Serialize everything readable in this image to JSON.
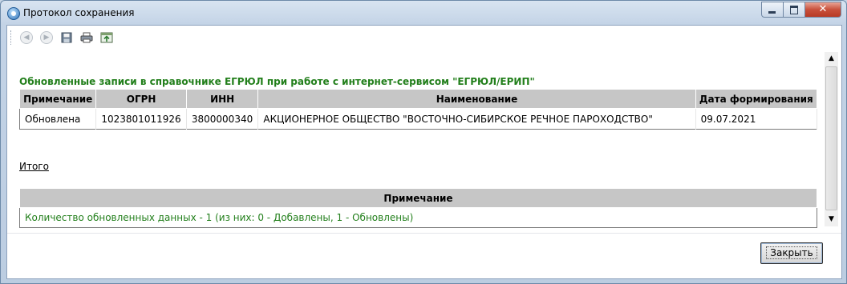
{
  "window": {
    "title": "Протокол сохранения"
  },
  "toolbar": {
    "icons": [
      "back-icon",
      "forward-icon",
      "save-icon",
      "print-icon",
      "export-icon"
    ]
  },
  "report": {
    "section_title": "Обновленные записи в справочнике ЕГРЮЛ при работе с интернет-сервисом \"ЕГРЮЛ/ЕРИП\"",
    "columns": [
      "Примечание",
      "ОГРН",
      "ИНН",
      "Наименование",
      "Дата формирования"
    ],
    "rows": [
      [
        "Обновлена",
        "1023801011926",
        "3800000340",
        "АКЦИОНЕРНОЕ ОБЩЕСТВО \"ВОСТОЧНО-СИБИРСКОЕ РЕЧНОЕ ПАРОХОДСТВО\"",
        "09.07.2021"
      ]
    ],
    "itogo_label": "Итого",
    "summary_column": "Примечание",
    "summary_text": "Количество обновленных данных - 1 (из них: 0 - Добавлены, 1 - Обновлены)"
  },
  "buttons": {
    "close_label": "Закрыть"
  },
  "colors": {
    "accent_green": "#227f1b",
    "header_gray": "#c6c6c6"
  }
}
